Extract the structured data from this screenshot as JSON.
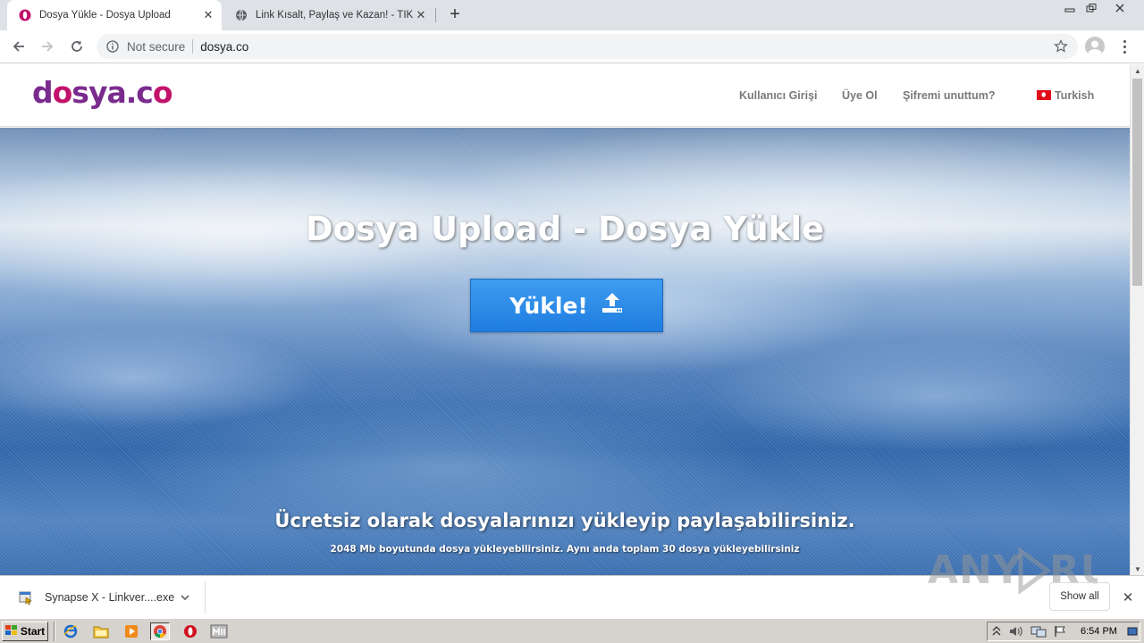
{
  "browser": {
    "tabs": [
      {
        "title": "Dosya Yükle - Dosya Upload",
        "active": true,
        "icon": "opera-favicon-icon"
      },
      {
        "title": "Link Kısalt, Paylaş ve Kazan! - TIK.L",
        "active": false,
        "icon": "globe-icon"
      }
    ],
    "new_tab_label": "+",
    "security_label": "Not secure",
    "url": "dosya.co"
  },
  "site": {
    "logo": {
      "part1": "d",
      "o": "o",
      "part2": "sya.c",
      "o2": "o"
    },
    "nav": {
      "login": "Kullanıcı Girişi",
      "register": "Üye Ol",
      "forgot": "Şifremi unuttum?",
      "language": "Turkish"
    },
    "hero": {
      "title": "Dosya Upload - Dosya Yükle",
      "upload_button": "Yükle!",
      "subtitle": "Ücretsiz olarak dosyalarınızı yükleyip paylaşabilirsiniz.",
      "note": "2048 Mb boyutunda dosya yükleyebilirsiniz. Aynı anda toplam 30 dosya yükleyebilirsiniz"
    }
  },
  "download_bar": {
    "file_name": "Synapse X - Linkver....exe",
    "show_all": "Show all",
    "watermark": "ANY RUN"
  },
  "taskbar": {
    "start_label": "Start",
    "clock": "6:54 PM"
  },
  "colors": {
    "logo_purple": "#7a2b8e",
    "logo_magenta": "#c2136a",
    "button_blue": "#2a8ae8",
    "nav_gray": "#7a7a7a"
  }
}
